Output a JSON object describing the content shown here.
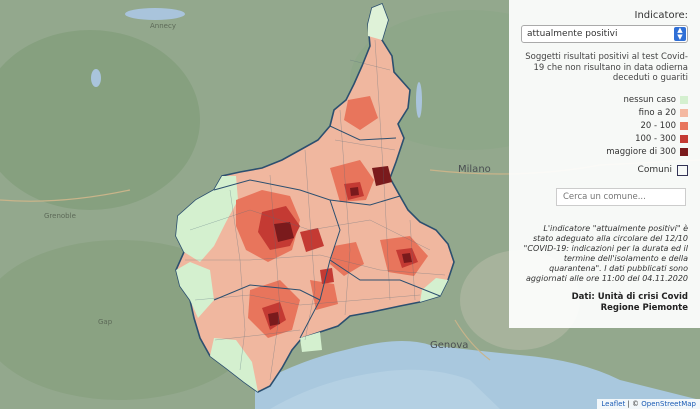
{
  "map": {
    "background_places": [
      "Annecy",
      "Grenoble",
      "Gap"
    ],
    "cities": [
      "Milano",
      "Genova"
    ],
    "region_colors": {
      "nessun_caso": "#d4f0cf",
      "fino_a_20": "#f4b8a0",
      "tra_20_100": "#e8755c",
      "tra_100_300": "#c43a33",
      "oltre_300": "#7a1a1c"
    }
  },
  "panel": {
    "indicator_label": "Indicatore:",
    "indicator_selected": "attualmente positivi",
    "description": "Soggetti risultati positivi al test Covid-19 che non risultano in data odierna deceduti o guariti",
    "legend": [
      {
        "label": "nessun caso",
        "color": "#d4f0cf"
      },
      {
        "label": "fino a 20",
        "color": "#f4b8a0"
      },
      {
        "label": "20 - 100",
        "color": "#e8755c"
      },
      {
        "label": "100 - 300",
        "color": "#c43a33"
      },
      {
        "label": "maggiore di 300",
        "color": "#7a1a1c"
      }
    ],
    "comuni_label": "Comuni",
    "search_placeholder": "Cerca un comune...",
    "note": "L'indicatore \"attualmente positivi\" è stato adeguato alla circolare del 12/10 \"COVID-19: indicazioni per la durata ed il termine dell'isolamento e della quarantena\". I dati pubblicati sono aggiornati alle ore 11:00 del 04.11.2020",
    "source_line1": "Dati: Unità di crisi Covid",
    "source_line2": "Regione Piemonte"
  },
  "attribution": {
    "prefix": "Leaflet",
    "sep": " | © ",
    "osm": "OpenStreetMap"
  }
}
